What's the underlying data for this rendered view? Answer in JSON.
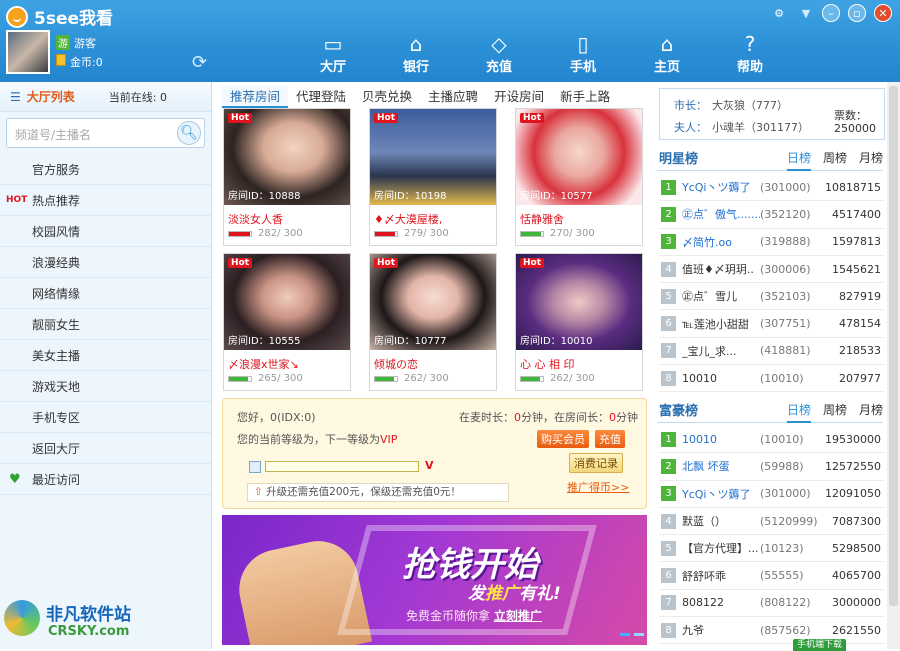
{
  "app": {
    "title": "5see我看"
  },
  "user": {
    "badge": "游",
    "name": "游客",
    "coins": "金币:0"
  },
  "nav": [
    {
      "label": "大厅",
      "icon": "▭"
    },
    {
      "label": "银行",
      "icon": "⌂"
    },
    {
      "label": "充值",
      "icon": "◇"
    },
    {
      "label": "手机",
      "icon": "▯"
    },
    {
      "label": "主页",
      "icon": "⌂"
    },
    {
      "label": "帮助",
      "icon": "?"
    }
  ],
  "sidebar": {
    "title": "大厅列表",
    "online": "当前在线: 0",
    "search_placeholder": "频道号/主播名",
    "items": [
      "官方服务",
      "热点推荐",
      "校园风情",
      "浪漫经典",
      "网络情缘",
      "靓丽女生",
      "美女主播",
      "游戏天地",
      "手机专区",
      "返回大厅",
      "最近访问"
    ],
    "hot_label": "HOT"
  },
  "tabs": [
    "推荐房间",
    "代理登陆",
    "贝壳兑换",
    "主播应聘",
    "开设房间",
    "新手上路"
  ],
  "rooms": [
    {
      "hot": "Hot",
      "id": "房间ID：10888",
      "name": "淡淡女人香",
      "count": "282/ 300",
      "fill": 0.94
    },
    {
      "hot": "Hot",
      "id": "房间ID：10198",
      "name": "♦〆大漠屋楼,",
      "count": "279/ 300",
      "fill": 0.93
    },
    {
      "hot": "Hot",
      "id": "房间ID：10577",
      "name": "恬静雅舍",
      "count": "270/ 300",
      "fill": 0.9
    },
    {
      "hot": "Hot",
      "id": "房间ID：10555",
      "name": "〆浪漫ⅹ世家↘",
      "count": "265/ 300",
      "fill": 0.88
    },
    {
      "hot": "Hot",
      "id": "房间ID：10777",
      "name": "倾城の恋",
      "count": "262/ 300",
      "fill": 0.87
    },
    {
      "hot": "Hot",
      "id": "房间ID：10010",
      "name": "心 心 相 印",
      "count": "262/ 300",
      "fill": 0.87
    }
  ],
  "info": {
    "greeting": "您好，0(IDX:0)",
    "mic_time_label": "在麦时长：",
    "mic_time": "0",
    "mic_unit": "分钟，在房间长：",
    "room_time": "0",
    "room_unit": "分钟",
    "level_text": "您的当前等级为，下一等级为",
    "vip": "VIP",
    "buy_vip": "购买会员",
    "recharge": "充值",
    "records": "消费记录",
    "upgrade": "升级还需充值200元，保级还需充值0元！",
    "promote": "推广得币>>"
  },
  "banner": {
    "headline": "抢钱开始",
    "sub1": "发",
    "sub2": "推广",
    "sub3": "有礼!",
    "line": "免费金币随你拿",
    "cta": "立刻推广"
  },
  "hall": {
    "leader_label": "市长：",
    "leader": "大灰狼（777）",
    "lady_label": "夫人：",
    "lady": "小魂羊（301177）",
    "votes_label": "票数：",
    "votes": "250000"
  },
  "star_rank": {
    "title": "明星榜",
    "tabs": [
      "日榜",
      "周榜",
      "月榜"
    ],
    "rows": [
      {
        "n": "1",
        "name": "YcQⅰ丶ツ薅了",
        "id": "(301000)",
        "v": "10818715",
        "hl": true
      },
      {
        "n": "2",
        "name": "㊣点゛傲气.......",
        "id": "(352120)",
        "v": "4517400",
        "hl": true
      },
      {
        "n": "3",
        "name": "〆简竹.oo",
        "id": "(319888)",
        "v": "1597813",
        "hl": true
      },
      {
        "n": "4",
        "name": "值班♦〆玥玥..",
        "id": "(300006)",
        "v": "1545621",
        "hl": false
      },
      {
        "n": "5",
        "name": "㊣点゛雪儿",
        "id": "(352103)",
        "v": "827919",
        "hl": false
      },
      {
        "n": "6",
        "name": "℡莲池小甜甜",
        "id": "(307751)",
        "v": "478154",
        "hl": false
      },
      {
        "n": "7",
        "name": "_宝儿_求...",
        "id": "(418881)",
        "v": "218533",
        "hl": false
      },
      {
        "n": "8",
        "name": "10010",
        "id": "(10010)",
        "v": "207977",
        "hl": false
      }
    ]
  },
  "rich_rank": {
    "title": "富豪榜",
    "tabs": [
      "日榜",
      "周榜",
      "月榜"
    ],
    "rows": [
      {
        "n": "1",
        "name": "10010",
        "id": "(10010)",
        "v": "19530000",
        "hl": true
      },
      {
        "n": "2",
        "name": "北飘 坏蛋",
        "id": "(59988)",
        "v": "12572550",
        "hl": true
      },
      {
        "n": "3",
        "name": "YcQⅰ丶ツ薅了",
        "id": "(301000)",
        "v": "12091050",
        "hl": true
      },
      {
        "n": "4",
        "name": "默蓝（）",
        "id": "(5120999)",
        "v": "7087300",
        "hl": false
      },
      {
        "n": "5",
        "name": "【官方代理】...",
        "id": "(10123)",
        "v": "5298500",
        "hl": false
      },
      {
        "n": "6",
        "name": "舒舒吥乖",
        "id": "(55555)",
        "v": "4065700",
        "hl": false
      },
      {
        "n": "7",
        "name": "808122",
        "id": "(808122)",
        "v": "3000000",
        "hl": false
      },
      {
        "n": "8",
        "name": "九爷",
        "id": "(857562)",
        "v": "2621550",
        "hl": false
      }
    ]
  },
  "mobile_download": "手机端下载",
  "watermark": {
    "name": "非凡软件站",
    "domain": "CRSKY.com"
  }
}
